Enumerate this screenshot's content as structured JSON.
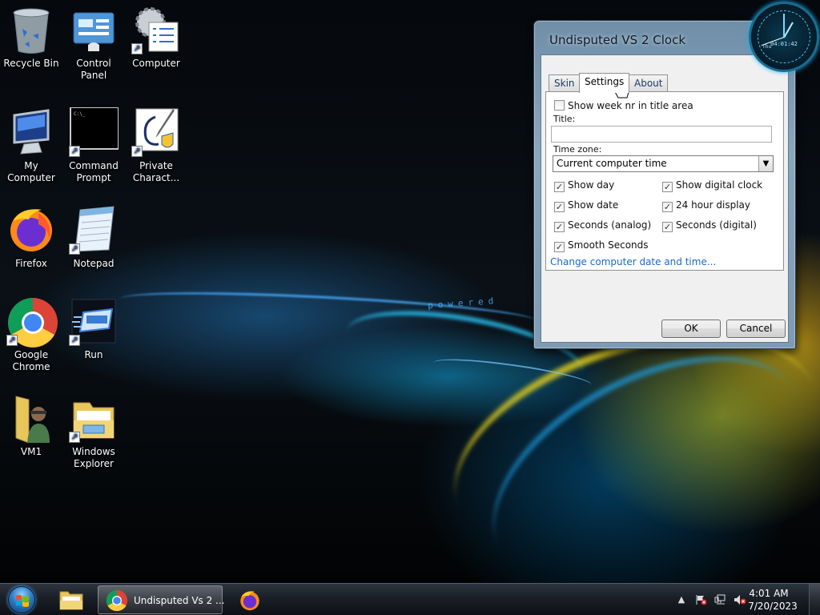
{
  "desktop": {
    "wallpaper_text": "powered",
    "icons": [
      {
        "label": "Recycle Bin"
      },
      {
        "label": "Control Panel"
      },
      {
        "label": "Computer"
      },
      {
        "label": "My Computer"
      },
      {
        "label": "Command Prompt"
      },
      {
        "label": "Private Charact..."
      },
      {
        "label": "Firefox"
      },
      {
        "label": "Notepad"
      },
      {
        "label": "Google Chrome"
      },
      {
        "label": "Run"
      },
      {
        "label": "VM1"
      },
      {
        "label": "Windows Explorer"
      }
    ]
  },
  "dialog": {
    "title": "Undisputed VS 2 Clock",
    "tabs": [
      {
        "label": "Skin"
      },
      {
        "label": "Settings"
      },
      {
        "label": "About"
      }
    ],
    "active_tab": "Settings",
    "show_week_label": "Show week nr in title area",
    "show_week_checked": false,
    "title_label": "Title:",
    "title_value": "",
    "timezone_label": "Time zone:",
    "timezone_value": "Current computer time",
    "options": [
      {
        "label": "Show day",
        "checked": true
      },
      {
        "label": "Show digital clock",
        "checked": true
      },
      {
        "label": "Show date",
        "checked": true
      },
      {
        "label": "24 hour display",
        "checked": true
      },
      {
        "label": "Seconds (analog)",
        "checked": true
      },
      {
        "label": "Seconds (digital)",
        "checked": true
      },
      {
        "label": "Smooth Seconds",
        "checked": true
      }
    ],
    "link": "Change computer date and time...",
    "ok_label": "OK",
    "cancel_label": "Cancel"
  },
  "gadget": {
    "day": "Thu",
    "time": "04:01:42"
  },
  "taskbar": {
    "task_label": "Undisputed Vs 2 ...",
    "clock_time": "4:01 AM",
    "clock_date": "7/20/2023"
  },
  "colors": {
    "link": "#1c69c9",
    "taskbar": "#1a1f27",
    "dialog_frame": "#7f9bb3"
  }
}
